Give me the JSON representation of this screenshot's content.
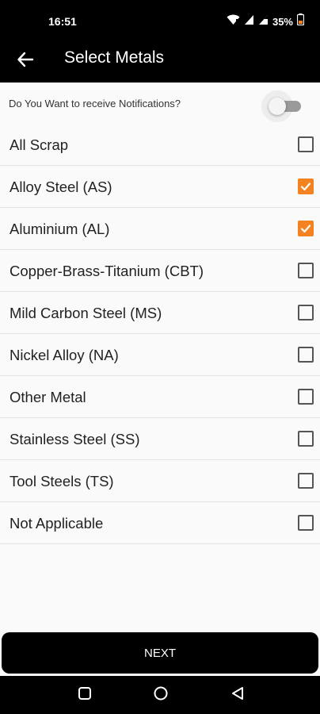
{
  "status_bar": {
    "time": "16:51",
    "battery": "35%",
    "icons": [
      "wifi-icon",
      "signal-icon",
      "signal-icon",
      "battery-icon"
    ]
  },
  "app_bar": {
    "title": "Select Metals",
    "back_icon": "arrow-left-icon"
  },
  "notifications": {
    "label": "Do You Want to receive Notifications?",
    "enabled": false
  },
  "metals": [
    {
      "label": "All Scrap",
      "checked": false
    },
    {
      "label": "Alloy Steel (AS)",
      "checked": true
    },
    {
      "label": "Aluminium (AL)",
      "checked": true
    },
    {
      "label": "Copper-Brass-Titanium (CBT)",
      "checked": false
    },
    {
      "label": "Mild Carbon Steel (MS)",
      "checked": false
    },
    {
      "label": "Nickel Alloy (NA)",
      "checked": false
    },
    {
      "label": "Other Metal",
      "checked": false
    },
    {
      "label": "Stainless Steel (SS)",
      "checked": false
    },
    {
      "label": "Tool Steels (TS)",
      "checked": false
    },
    {
      "label": "Not Applicable",
      "checked": false
    }
  ],
  "next_button": {
    "label": "NEXT"
  },
  "nav_bar": {
    "recents_icon": "square-icon",
    "home_icon": "circle-icon",
    "back_icon": "triangle-back-icon"
  },
  "colors": {
    "accent": "#f58220",
    "bar": "#000000",
    "background": "#fafafa"
  }
}
